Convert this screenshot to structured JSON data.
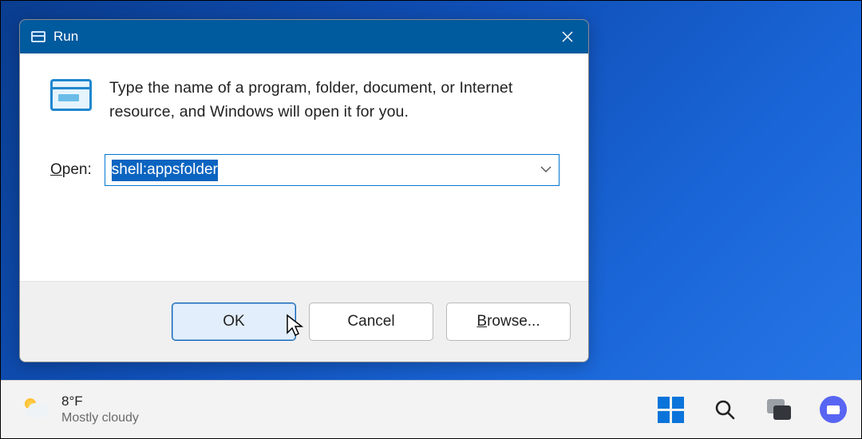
{
  "dialog": {
    "title": "Run",
    "description": "Type the name of a program, folder, document, or Internet resource, and Windows will open it for you.",
    "open_label_underline": "O",
    "open_label_rest": "pen:",
    "input_value": "shell:appsfolder",
    "buttons": {
      "ok": "OK",
      "cancel": "Cancel",
      "browse_underline": "B",
      "browse_rest": "rowse..."
    }
  },
  "taskbar": {
    "temperature": "8°F",
    "condition": "Mostly cloudy"
  }
}
